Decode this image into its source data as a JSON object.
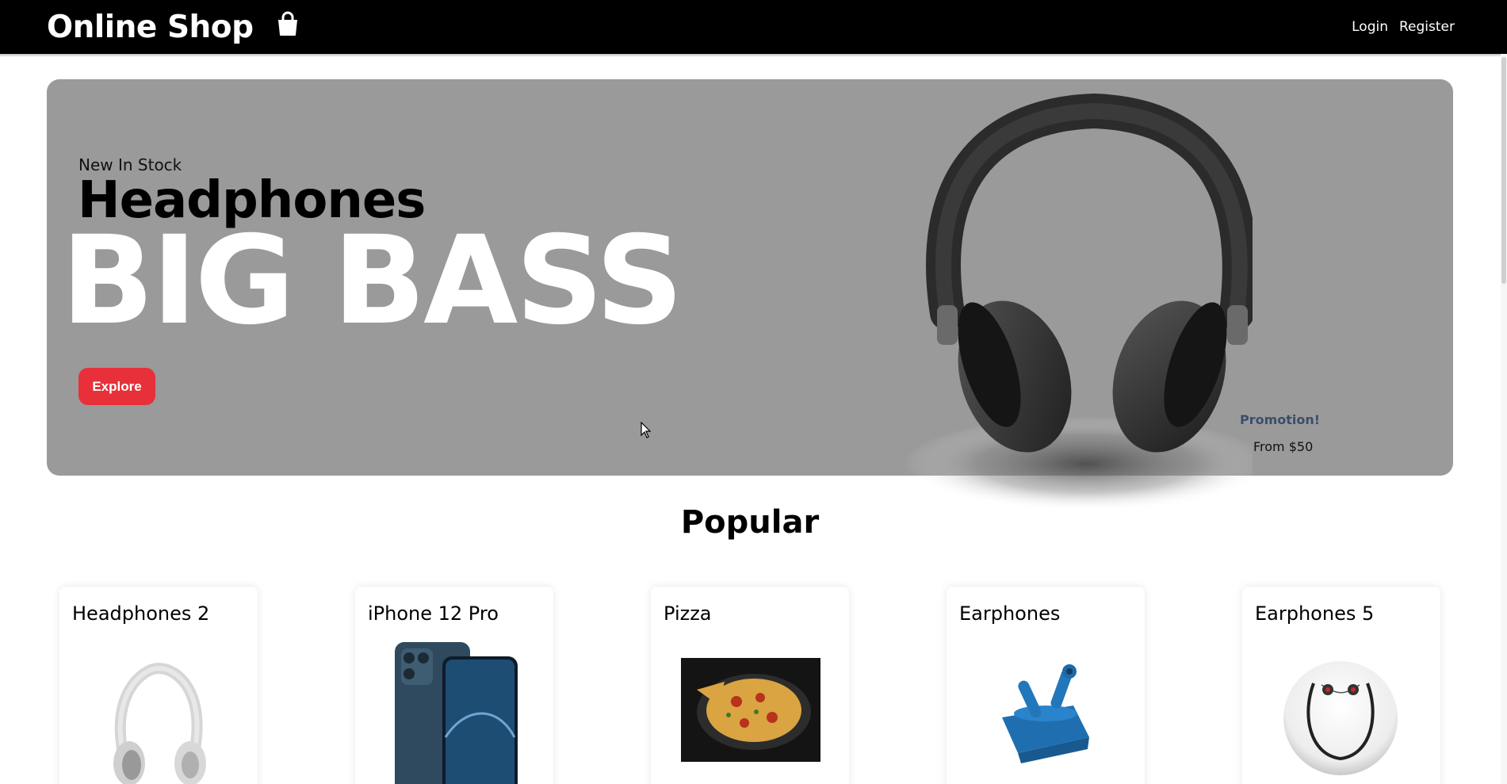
{
  "navbar": {
    "title": "Online Shop",
    "icon": "shopping-bag-icon",
    "links": [
      "Login",
      "Register"
    ]
  },
  "hero": {
    "small_text": "New In Stock",
    "mid_text": "Headphones",
    "big_text": "BIG BASS",
    "button_label": "Explore",
    "promo_title": "Promotion!",
    "promo_price": "From $50",
    "image": "headphones-image",
    "colors": {
      "background": "#9a9a9a",
      "button": "#e8303a",
      "promo": "#3b4e6b"
    }
  },
  "popular": {
    "title": "Popular",
    "products": [
      {
        "name": "Headphones 2",
        "image": "white-headphones-image"
      },
      {
        "name": "iPhone 12 Pro",
        "image": "iphone-image"
      },
      {
        "name": "Pizza",
        "image": "pizza-image"
      },
      {
        "name": "Earphones",
        "image": "blue-earbuds-image"
      },
      {
        "name": "Earphones 5",
        "image": "neckband-earphones-image"
      }
    ]
  }
}
